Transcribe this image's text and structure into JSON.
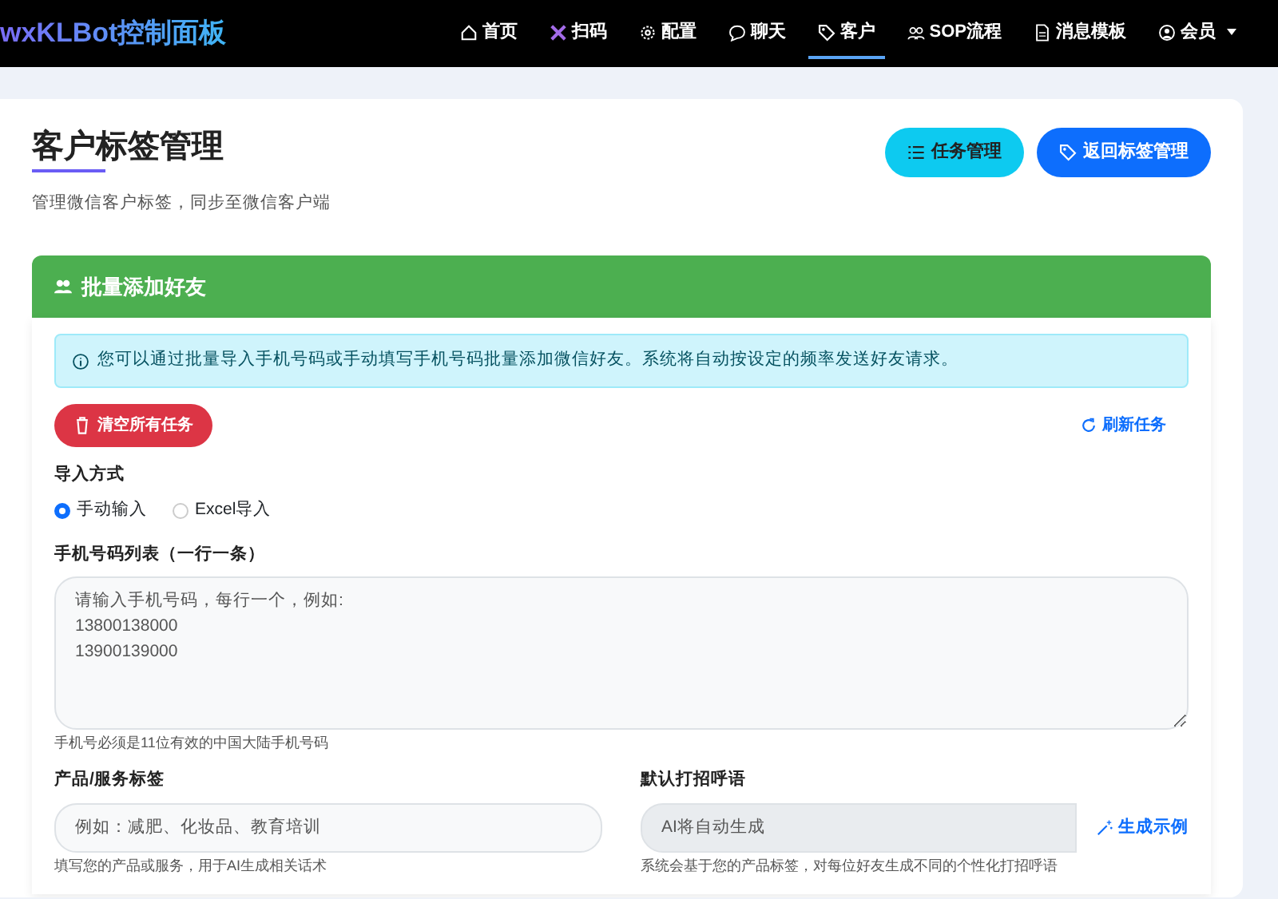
{
  "navbar": {
    "brand": "wxKLBot控制面板",
    "items": [
      {
        "label": "首页",
        "kind": "home",
        "selected": false,
        "dropdown": false
      },
      {
        "label": "扫码",
        "kind": "scan",
        "selected": false,
        "dropdown": false
      },
      {
        "label": "配置",
        "kind": "gear",
        "selected": false,
        "dropdown": false
      },
      {
        "label": "聊天",
        "kind": "chat",
        "selected": false,
        "dropdown": false
      },
      {
        "label": "客户",
        "kind": "tag",
        "selected": true,
        "dropdown": false
      },
      {
        "label": "SOP流程",
        "kind": "people",
        "selected": false,
        "dropdown": false
      },
      {
        "label": "消息模板",
        "kind": "doc",
        "selected": false,
        "dropdown": false
      },
      {
        "label": "会员",
        "kind": "user",
        "selected": false,
        "dropdown": true
      }
    ]
  },
  "page": {
    "title": "客户标签管理",
    "subtitle": "管理微信客户标签，同步至微信客户端",
    "buttons": [
      {
        "label": "任务管理",
        "kind": "info"
      },
      {
        "label": "返回标签管理",
        "kind": "primary"
      }
    ]
  },
  "panel": {
    "title": "批量添加好友",
    "alert": "您可以通过批量导入手机号码或手动填写手机号码批量添加微信好友。系统将自动按设定的频率发送好友请求。",
    "clear_button": "清空所有任务",
    "refresh_link": "刷新任务",
    "import_label": "导入方式",
    "import_options": [
      {
        "label": "手动输入",
        "selected": true
      },
      {
        "label": "Excel导入",
        "selected": false
      }
    ],
    "phones": {
      "label": "手机号码列表（一行一条）",
      "placeholder": "请输入手机号码，每行一个，例如:\n13800138000\n13900139000",
      "help": "手机号必须是11位有效的中国大陆手机号码"
    },
    "product": {
      "label": "产品/服务标签",
      "placeholder": "例如：减肥、化妆品、教育培训",
      "help": "填写您的产品或服务，用于AI生成相关话术"
    },
    "greeting": {
      "label": "默认打招呼语",
      "placeholder": "AI将自动生成",
      "button": "生成示例",
      "help": "系统会基于您的产品标签，对每位好友生成不同的个性化打招呼语"
    }
  }
}
